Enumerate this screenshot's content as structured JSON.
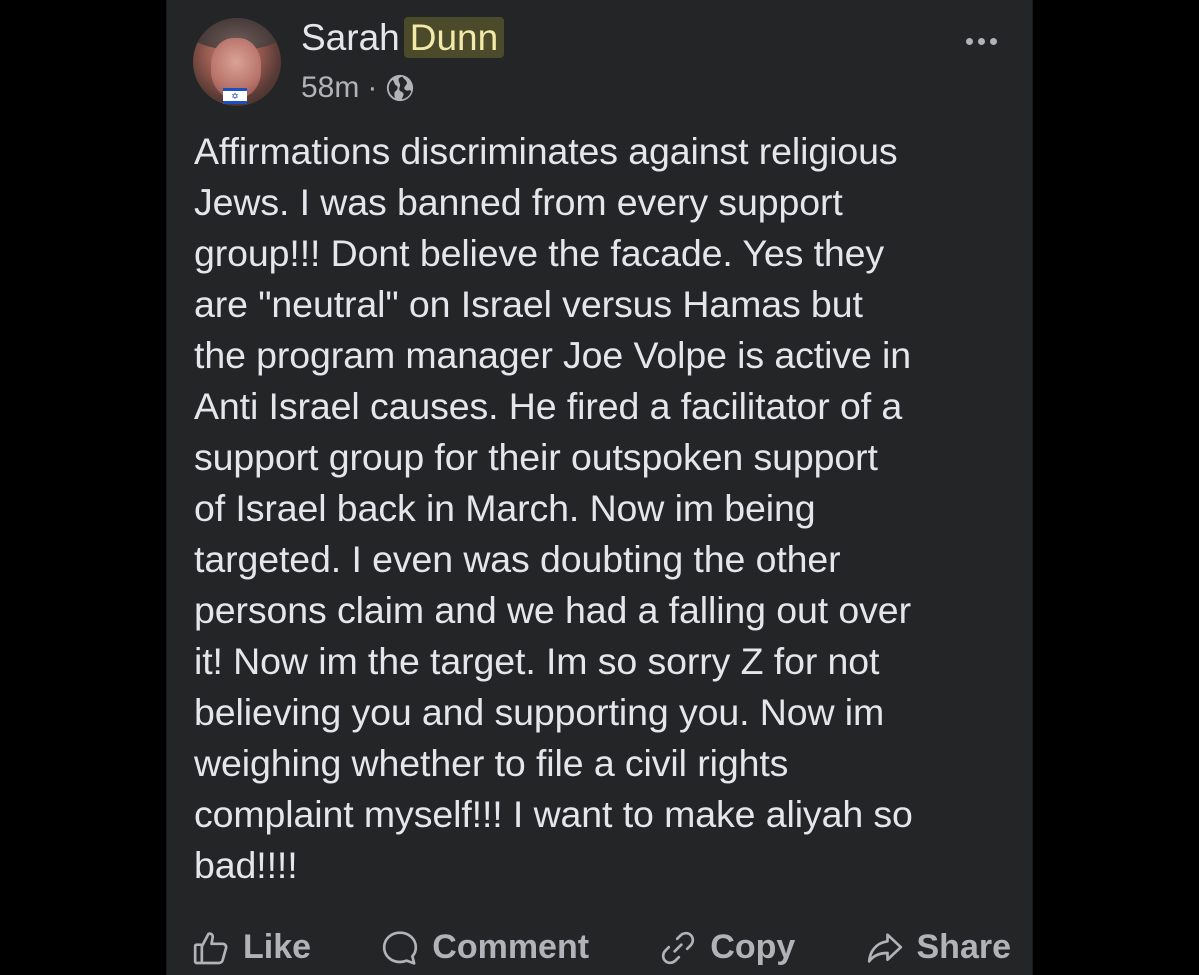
{
  "post": {
    "author_first": "Sarah",
    "author_last": "Dunn",
    "time": "58m",
    "separator": "·",
    "visibility_icon": "globe-icon",
    "menu_icon": "more-horizontal-icon",
    "body": "Affirmations discriminates against religious\nJews. I was banned from every support\ngroup!!! Dont believe the facade. Yes they\nare \"neutral\" on Israel versus Hamas but\nthe program manager Joe Volpe is active in\nAnti Israel causes. He fired a facilitator of a\nsupport group for their outspoken support\nof Israel back in March. Now im being\ntargeted. I even was doubting the other\npersons claim and we had a falling out over\nit! Now im the target. Im so sorry Z for not\nbelieving you and supporting you. Now im\nweighing whether to file a civil rights\ncomplaint myself!!! I want to make aliyah so\nbad!!!!"
  },
  "actions": {
    "like": {
      "label": "Like",
      "icon": "thumbs-up-icon"
    },
    "comment": {
      "label": "Comment",
      "icon": "comment-bubble-icon"
    },
    "copy": {
      "label": "Copy",
      "icon": "link-icon"
    },
    "share": {
      "label": "Share",
      "icon": "share-arrow-icon"
    }
  },
  "colors": {
    "background": "#242526",
    "text_primary": "#e4e6eb",
    "text_secondary": "#b0b3b8",
    "highlight": "#4b4a2a"
  }
}
